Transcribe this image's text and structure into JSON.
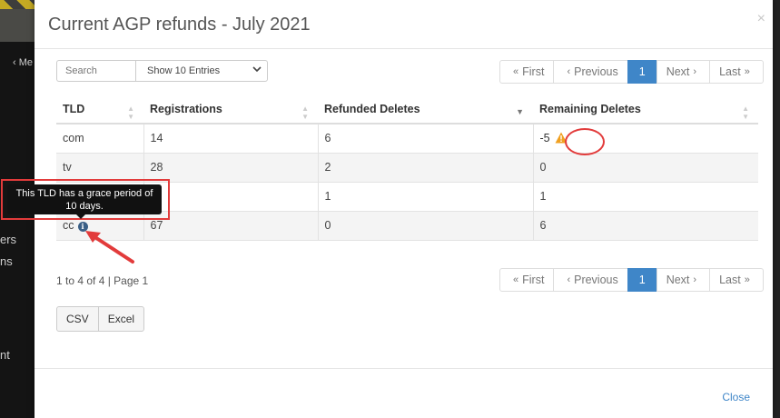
{
  "background": {
    "side_texts": [
      "‹ Me",
      "ers",
      "ns",
      "nt"
    ]
  },
  "modal": {
    "title": "Current AGP refunds - July 2021",
    "close_icon": "×"
  },
  "search": {
    "placeholder": "Search"
  },
  "entries_select": {
    "selected": "Show 10 Entries"
  },
  "pagination": {
    "first": "First",
    "previous": "Previous",
    "current": "1",
    "next": "Next",
    "last": "Last"
  },
  "table": {
    "headers": [
      "TLD",
      "Registrations",
      "Refunded Deletes",
      "Remaining Deletes"
    ],
    "rows": [
      {
        "tld": "com",
        "registrations": "14",
        "refunded": "6",
        "remaining": "-5"
      },
      {
        "tld": "tv",
        "registrations": "28",
        "refunded": "2",
        "remaining": "0"
      },
      {
        "tld": "",
        "registrations": "",
        "refunded": "1",
        "remaining": "1"
      },
      {
        "tld": "cc",
        "registrations": "67",
        "refunded": "0",
        "remaining": "6"
      }
    ]
  },
  "tooltip": {
    "text": "This TLD has a grace period of 10 days."
  },
  "summary": "1 to 4 of 4 | Page 1",
  "export_buttons": {
    "csv": "CSV",
    "excel": "Excel"
  },
  "footer": {
    "close": "Close"
  },
  "colors": {
    "accent": "#3f86c8",
    "highlight": "#e23b3b",
    "warning": "#f0a020"
  }
}
